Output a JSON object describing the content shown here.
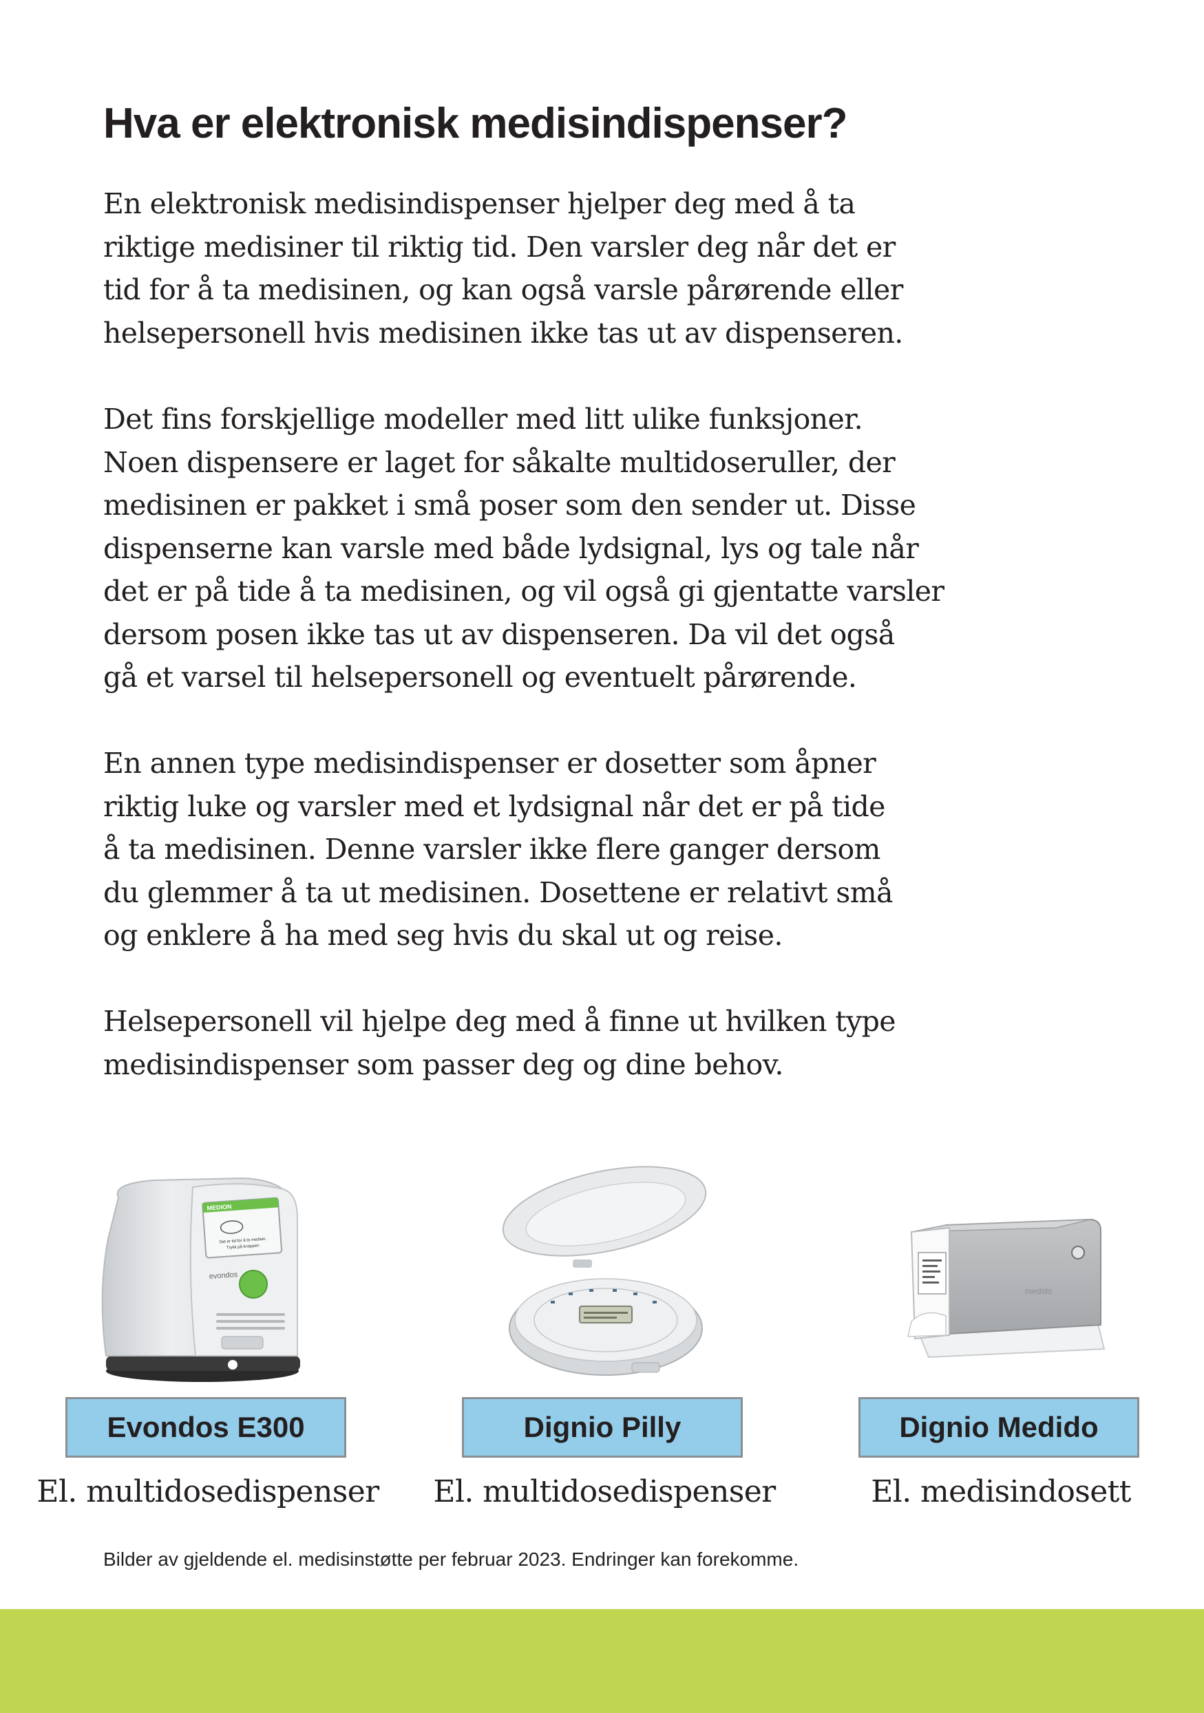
{
  "title": "Hva er elektronisk medisindispenser?",
  "paragraphs": [
    [
      "En elektronisk medisindispenser hjelper deg med å ta",
      "riktige medisiner til riktig tid. Den varsler deg når det er",
      "tid for å ta medisinen, og kan også varsle pårørende eller",
      "helsepersonell hvis medisinen ikke tas ut av dispenseren."
    ],
    [
      "Det fins forskjellige modeller med litt ulike funksjoner.",
      "Noen dispensere er laget for såkalte multidoseruller, der",
      "medisinen er pakket i små poser som den sender ut. Disse",
      "dispenserne kan varsle med både lydsignal, lys og tale når",
      "det er på tide å ta medisinen, og vil også gi gjentatte varsler",
      "dersom posen ikke tas ut av dispenseren. Da vil det også",
      "gå et varsel til helsepersonell og eventuelt pårørende."
    ],
    [
      "En annen type medisindispenser er dosetter som åpner",
      "riktig luke og varsler med et lydsignal når det er på tide",
      "å ta medisinen. Denne varsler ikke flere ganger dersom",
      "du glemmer å ta ut medisinen. Dosettene er relativt små",
      "og enklere å ha med seg hvis du skal ut og reise."
    ],
    [
      "Helsepersonell vil hjelpe deg med å finne ut hvilken type",
      "medisindispenser som passer deg og dine behov."
    ]
  ],
  "products": [
    {
      "name": "Evondos E300",
      "type": "El. multidosedispenser",
      "screen_brand": "MEDION",
      "screen_text": [
        "Det er tid for å ta medisin.",
        "Trykk på knappen."
      ],
      "device_brand": "evondos"
    },
    {
      "name": "Dignio Pilly",
      "type": "El. multidosedispenser"
    },
    {
      "name": "Dignio Medido",
      "type": "El. medisindosett",
      "device_brand": "medido"
    }
  ],
  "footnote": "Bilder av gjeldende el. medisinstøtte per februar 2023. Endringer kan forekomme.",
  "colors": {
    "text": "#231f20",
    "name_box_fill": "#94cdea",
    "name_box_border": "#8a8f93",
    "bottom_band": "#c0d651",
    "device_accent_green": "#6cc04a"
  }
}
